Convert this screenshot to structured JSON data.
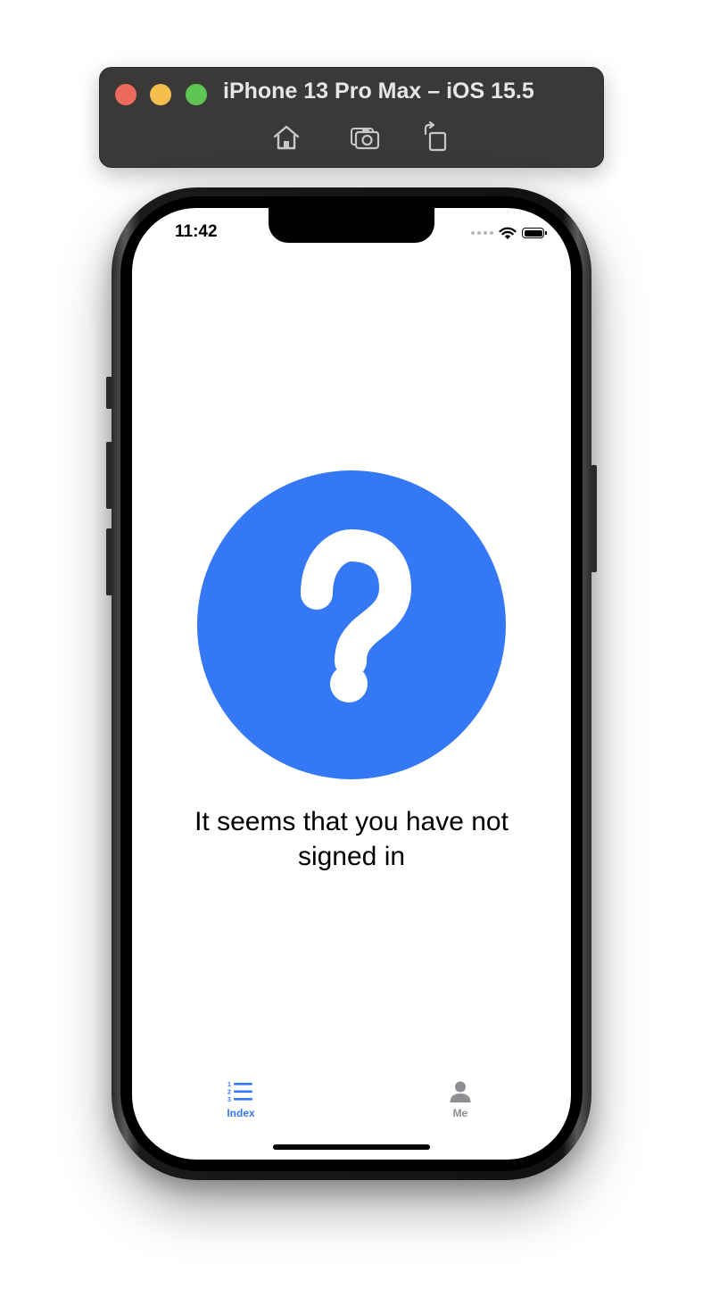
{
  "window": {
    "title": "iPhone 13 Pro Max – iOS 15.5",
    "toolbar": [
      {
        "icon": "home-icon"
      },
      {
        "icon": "screenshot-camera-icon"
      },
      {
        "icon": "rotate-icon"
      }
    ]
  },
  "status_bar": {
    "time": "11:42"
  },
  "main": {
    "icon": "question-mark-circle-icon",
    "message": "It seems that you have not signed in"
  },
  "tab_bar": {
    "tabs": [
      {
        "label": "Index",
        "icon": "numbered-list-icon",
        "active": true
      },
      {
        "label": "Me",
        "icon": "person-icon",
        "active": false
      }
    ]
  },
  "colors": {
    "accent": "#3478f6",
    "inactive": "#8e8e93",
    "window_bar": "#3a3938"
  }
}
